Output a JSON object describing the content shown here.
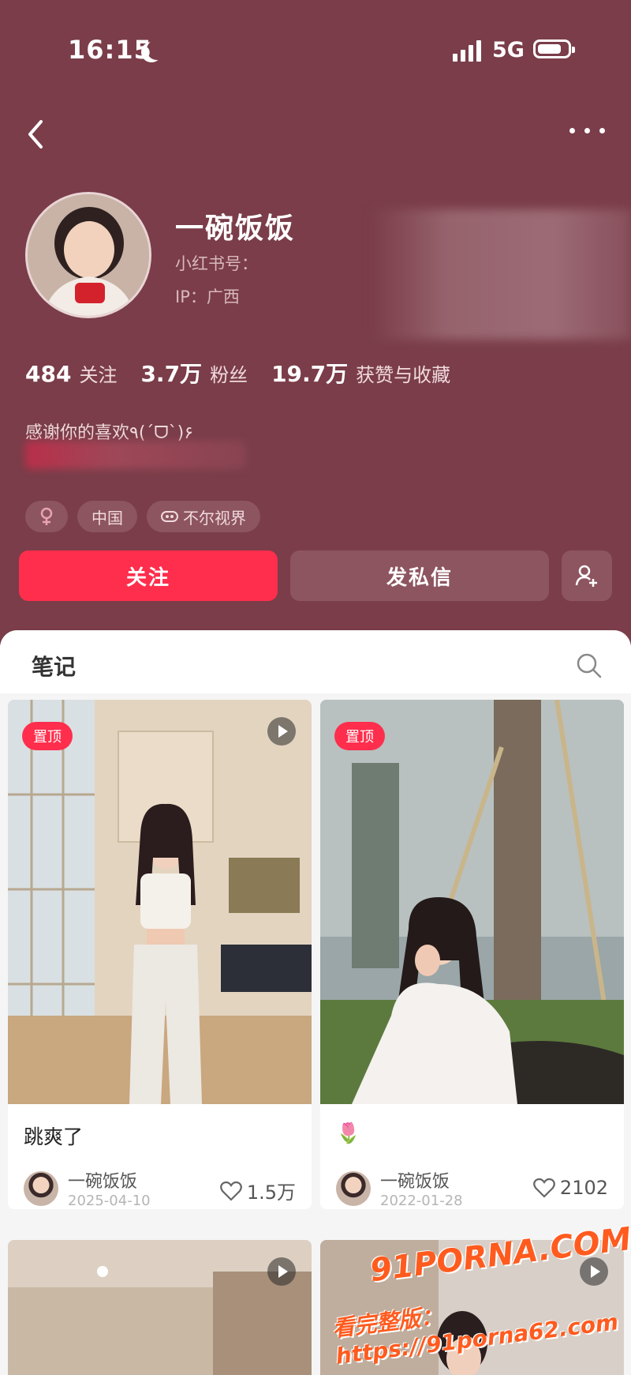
{
  "status_bar": {
    "time": "16:15",
    "network": "5G"
  },
  "profile": {
    "name": "一碗饭饭",
    "id_label": "小红书号：",
    "ip_label": "IP：广西",
    "stats": [
      {
        "value": "484",
        "label": "关注"
      },
      {
        "value": "3.7万",
        "label": "粉丝"
      },
      {
        "value": "19.7万",
        "label": "获赞与收藏"
      }
    ],
    "bio": "感谢你的喜欢٩(ˊᗜˋ)۶",
    "tags": [
      {
        "icon": "female-icon",
        "text": ""
      },
      {
        "icon": "",
        "text": "中国"
      },
      {
        "icon": "vision-icon",
        "text": "不尔视界"
      }
    ]
  },
  "actions": {
    "follow": "关注",
    "message": "发私信"
  },
  "notes": {
    "tab_title": "笔记",
    "cards": [
      {
        "pinned_label": "置顶",
        "title": "跳爽了",
        "author": "一碗饭饭",
        "date": "2025-04-10",
        "likes": "1.5万"
      },
      {
        "pinned_label": "置顶",
        "title": "🌷",
        "author": "一碗饭饭",
        "date": "2022-01-28",
        "likes": "2102"
      }
    ]
  },
  "watermark": {
    "line1": "91PORNA.COM",
    "line2": "看完整版：https://91porna62.com"
  },
  "colors": {
    "header_bg": "#7a3d49",
    "accent": "#ff2e4d"
  }
}
